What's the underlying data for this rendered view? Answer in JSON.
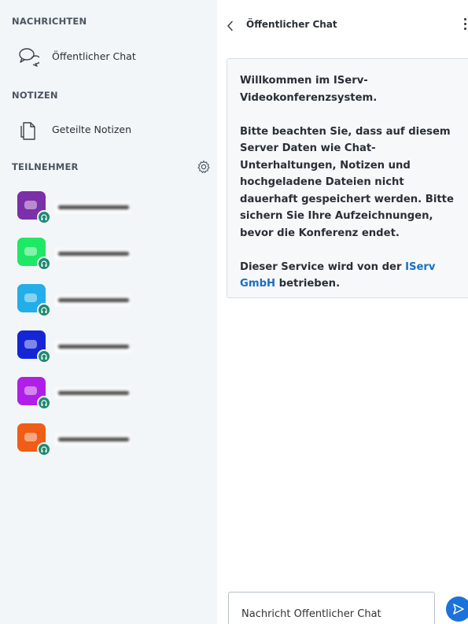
{
  "sidebar": {
    "messages_section": "NACHRICHTEN",
    "public_chat_label": "Öffentlicher Chat",
    "notes_section": "NOTIZEN",
    "shared_notes_label": "Geteilte Notizen",
    "participants_section": "TEILNEHMER",
    "participants": [
      {
        "avatar_color": "#7b2fa8",
        "status": "audio"
      },
      {
        "avatar_color": "#1ee866",
        "status": "audio"
      },
      {
        "avatar_color": "#22aee8",
        "status": "audio"
      },
      {
        "avatar_color": "#1426d6",
        "status": "audio"
      },
      {
        "avatar_color": "#b01fe8",
        "status": "audio"
      },
      {
        "avatar_color": "#f05d16",
        "status": "audio"
      }
    ]
  },
  "chat": {
    "back_title": "Öffentlicher Chat",
    "welcome": {
      "line1": "Willkommen im IServ-Videokonferenzsystem.",
      "line2": "Bitte beachten Sie, dass auf diesem Server Daten wie Chat-Unterhaltungen, Notizen und hochgeladene Dateien nicht dauerhaft gespeichert werden. Bitte sichern Sie Ihre Aufzeichnungen, bevor die Konferenz endet.",
      "line3_prefix": "Dieser Service wird von der",
      "link_text": "IServ GmbH",
      "line3_suffix": "betrieben."
    },
    "input_placeholder": "Nachricht Öffentlicher Chat"
  },
  "colors": {
    "sidebar_bg": "#f3f6f9",
    "accent": "#1b73d9",
    "link": "#1a6fc0",
    "audio_badge": "#1f8a70"
  }
}
